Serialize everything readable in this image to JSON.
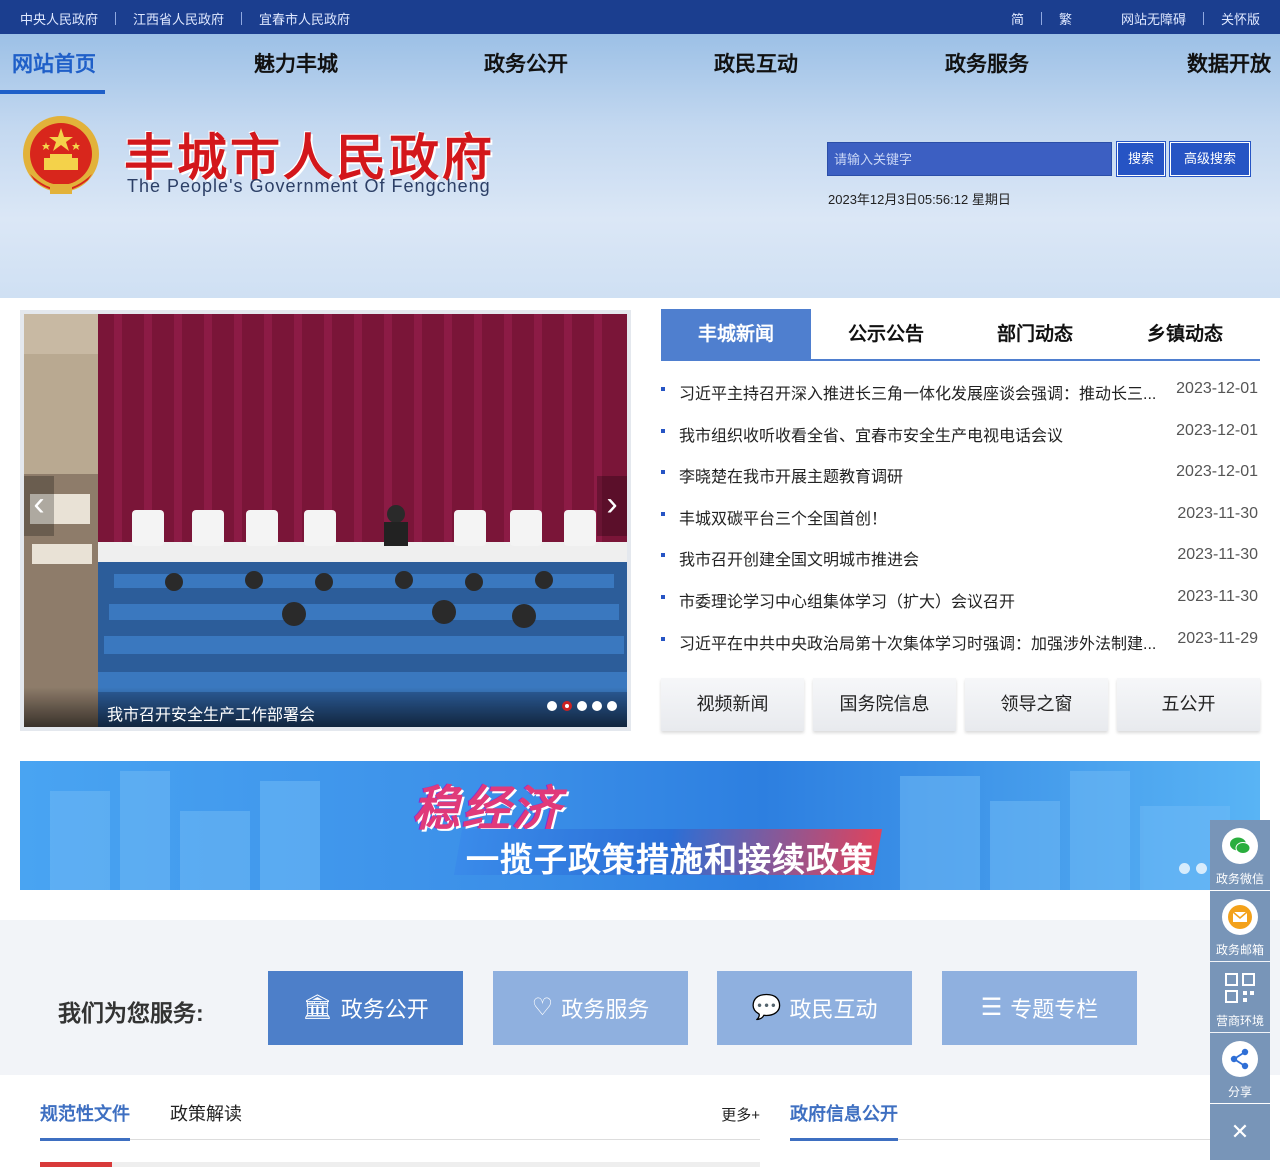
{
  "topbar": {
    "links_left": [
      "中央人民政府",
      "江西省人民政府",
      "宜春市人民政府"
    ],
    "links_right": [
      "简",
      "繁",
      "网站无障碍",
      "关怀版"
    ]
  },
  "nav": {
    "items": [
      "网站首页",
      "魅力丰城",
      "政务公开",
      "政民互动",
      "政务服务",
      "数据开放"
    ]
  },
  "header": {
    "title": "丰城市人民政府",
    "subtitle": "The  People's Government  Of  Fengcheng",
    "search_placeholder": "请输入关键字",
    "search_button": "搜索",
    "advanced_button": "高级搜索",
    "datetime": "2023年12月3日05:56:12 星期日"
  },
  "slider": {
    "caption": "我市召开安全生产工作部署会",
    "dot_count": 5,
    "active_dot": 1
  },
  "news": {
    "tabs": [
      "丰城新闻",
      "公示公告",
      "部门动态",
      "乡镇动态"
    ],
    "items": [
      {
        "title": "习近平主持召开深入推进长三角一体化发展座谈会强调：推动长三...",
        "date": "2023-12-01"
      },
      {
        "title": "我市组织收听收看全省、宜春市安全生产电视电话会议",
        "date": "2023-12-01"
      },
      {
        "title": "李晓楚在我市开展主题教育调研",
        "date": "2023-12-01"
      },
      {
        "title": "丰城双碳平台三个全国首创！",
        "date": "2023-11-30"
      },
      {
        "title": "我市召开创建全国文明城市推进会",
        "date": "2023-11-30"
      },
      {
        "title": "市委理论学习中心组集体学习（扩大）会议召开",
        "date": "2023-11-30"
      },
      {
        "title": "习近平在中共中央政治局第十次集体学习时强调：加强涉外法制建...",
        "date": "2023-11-29"
      }
    ],
    "quick_buttons": [
      "视频新闻",
      "国务院信息",
      "领导之窗",
      "五公开"
    ]
  },
  "banner": {
    "headline": "稳经济",
    "tagline": "一揽子政策措施和接续政策"
  },
  "services": {
    "label": "我们为您服务:",
    "buttons": [
      {
        "label": "政务公开",
        "icon": "building-icon"
      },
      {
        "label": "政务服务",
        "icon": "heart-hand-icon"
      },
      {
        "label": "政民互动",
        "icon": "chat-icon"
      },
      {
        "label": "专题专栏",
        "icon": "list-icon"
      }
    ]
  },
  "sections": {
    "left_tabs": [
      "规范性文件",
      "政策解读"
    ],
    "more": "更多+",
    "right_title": "政府信息公开"
  },
  "float_bar": {
    "items": [
      "政务微信",
      "政务邮箱",
      "营商环境",
      "分享"
    ],
    "close": "✕"
  },
  "colors": {
    "topbar": "#1b3e8f",
    "accent": "#1f5fc8",
    "title_red": "#d3171b"
  }
}
